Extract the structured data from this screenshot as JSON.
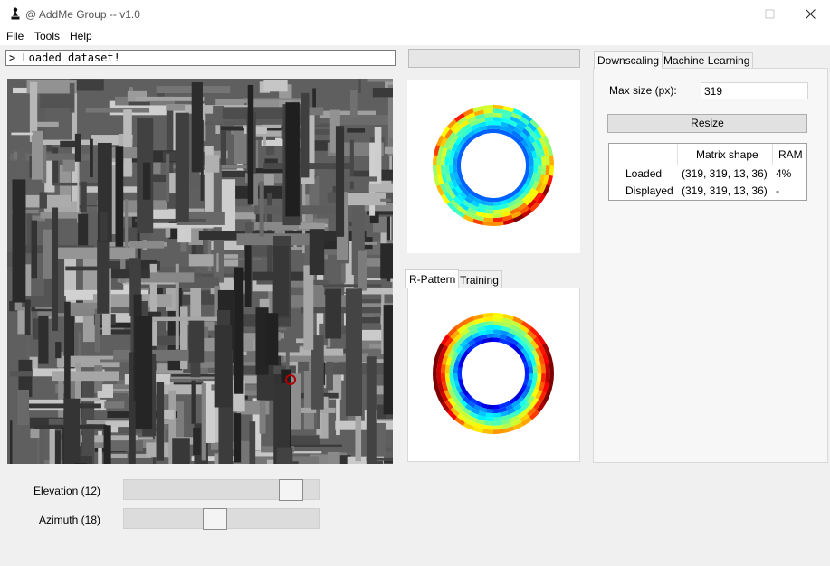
{
  "window": {
    "title": "@ AddMe Group -- v1.0"
  },
  "menu": [
    "File",
    "Tools",
    "Help"
  ],
  "console": {
    "text": "> Loaded dataset!"
  },
  "sliders": [
    {
      "label": "Elevation (12)",
      "value": 12,
      "fraction": 0.9
    },
    {
      "label": "Azimuth (18)",
      "value": 18,
      "fraction": 0.46
    }
  ],
  "plot_tabs": [
    "R-Pattern",
    "Training"
  ],
  "right_tabs": [
    "Downscaling",
    "Machine Learning"
  ],
  "downscaling": {
    "max_size_label": "Max size (px):",
    "max_size_value": "319",
    "resize_label": "Resize",
    "table": {
      "headers": [
        "",
        "Matrix shape",
        "RAM"
      ],
      "rows": [
        [
          "Loaded",
          "(319, 319, 13, 36)",
          "4%"
        ],
        [
          "Displayed",
          "(319, 319, 13, 36)",
          "-"
        ]
      ]
    }
  },
  "colors": {
    "marker": "#b00000",
    "colormap": "jet"
  },
  "icons": {
    "app": "chess-pawn-icon",
    "minimize": "minimize-icon",
    "maximize": "maximize-icon",
    "close": "close-icon"
  }
}
